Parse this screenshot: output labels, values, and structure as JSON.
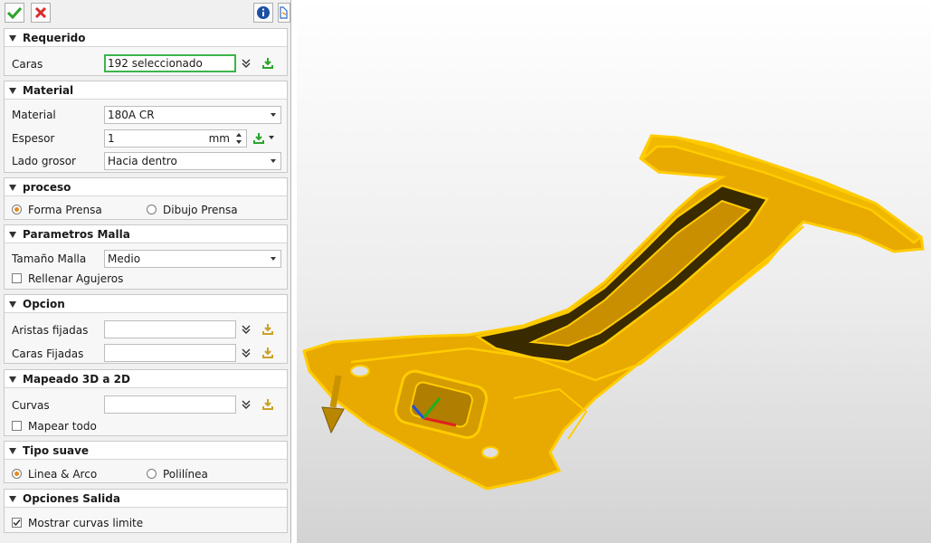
{
  "sections": {
    "requerido": {
      "title": "Requerido",
      "caras_label": "Caras",
      "caras_value": "192 seleccionado"
    },
    "material": {
      "title": "Material",
      "material_label": "Material",
      "material_value": "180A CR",
      "espesor_label": "Espesor",
      "espesor_value": "1",
      "espesor_unit": "mm",
      "lado_label": "Lado grosor",
      "lado_value": "Hacia dentro"
    },
    "proceso": {
      "title": "proceso",
      "opt1": "Forma Prensa",
      "opt2": "Dibujo Prensa",
      "selected": "Forma Prensa"
    },
    "malla": {
      "title": "Parametros Malla",
      "tamano_label": "Tamaño Malla",
      "tamano_value": "Medio",
      "rellenar_label": "Rellenar Agujeros",
      "rellenar_checked": false
    },
    "opcion": {
      "title": "Opcion",
      "aristas_label": "Aristas fijadas",
      "aristas_value": "",
      "caras_label": "Caras Fijadas",
      "caras_value": ""
    },
    "mapeado": {
      "title": "Mapeado 3D a 2D",
      "curvas_label": "Curvas",
      "curvas_value": "",
      "mapear_label": "Mapear todo",
      "mapear_checked": false
    },
    "suave": {
      "title": "Tipo suave",
      "opt1": "Linea & Arco",
      "opt2": "Polilínea",
      "selected": "Linea & Arco"
    },
    "salida": {
      "title": "Opciones Salida",
      "mostrar_label": "Mostrar curvas limite",
      "mostrar_checked": true
    }
  },
  "colors": {
    "accent_green": "#3cb44b",
    "part_fill": "#f2b400",
    "part_edge": "#ffcc00",
    "radio_dot": "#e58a1f"
  },
  "icons": [
    "check-icon",
    "close-icon",
    "info-icon",
    "help-icon",
    "chevron-double-down-icon",
    "pick-icon",
    "dropdown-arrow-icon"
  ]
}
